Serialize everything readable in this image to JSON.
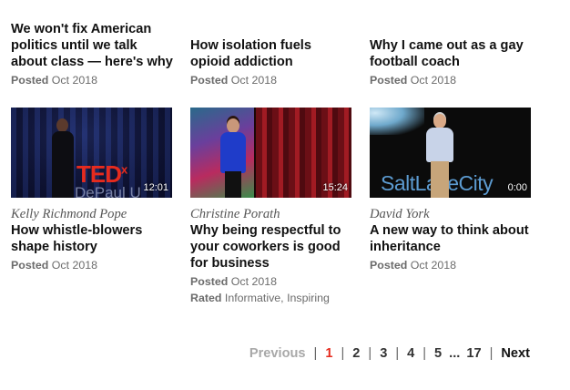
{
  "top_row": [
    {
      "title": "We won't fix American politics until we talk about class — here's why",
      "posted_label": "Posted",
      "posted_date": "Oct 2018"
    },
    {
      "title": "How isolation fuels opioid addiction",
      "posted_label": "Posted",
      "posted_date": "Oct 2018"
    },
    {
      "title": "Why I came out as a gay football coach",
      "posted_label": "Posted",
      "posted_date": "Oct 2018"
    }
  ],
  "bottom_row": [
    {
      "duration": "12:01",
      "speaker": "Kelly Richmond Pope",
      "title": "How whistle-blowers shape history",
      "posted_label": "Posted",
      "posted_date": "Oct 2018",
      "stage_text": "TED",
      "stage_sup": "x",
      "stage_sub": "DePaul U"
    },
    {
      "duration": "15:24",
      "speaker": "Christine Porath",
      "title": "Why being respectful to your coworkers is good for business",
      "posted_label": "Posted",
      "posted_date": "Oct 2018",
      "rated_label": "Rated",
      "rated_value": "Informative, Inspiring"
    },
    {
      "duration": "0:00",
      "speaker": "David York",
      "title": "A new way to think about inheritance",
      "posted_label": "Posted",
      "posted_date": "Oct 2018",
      "stage_text": "SaltLakeCity"
    }
  ],
  "pagination": {
    "previous": "Previous",
    "pages": [
      "1",
      "2",
      "3",
      "4",
      "5"
    ],
    "current": "1",
    "ellipsis": "...",
    "last": "17",
    "next": "Next"
  },
  "colors": {
    "accent": "#e62b1e",
    "text": "#111111",
    "meta": "#6b6b6b"
  }
}
